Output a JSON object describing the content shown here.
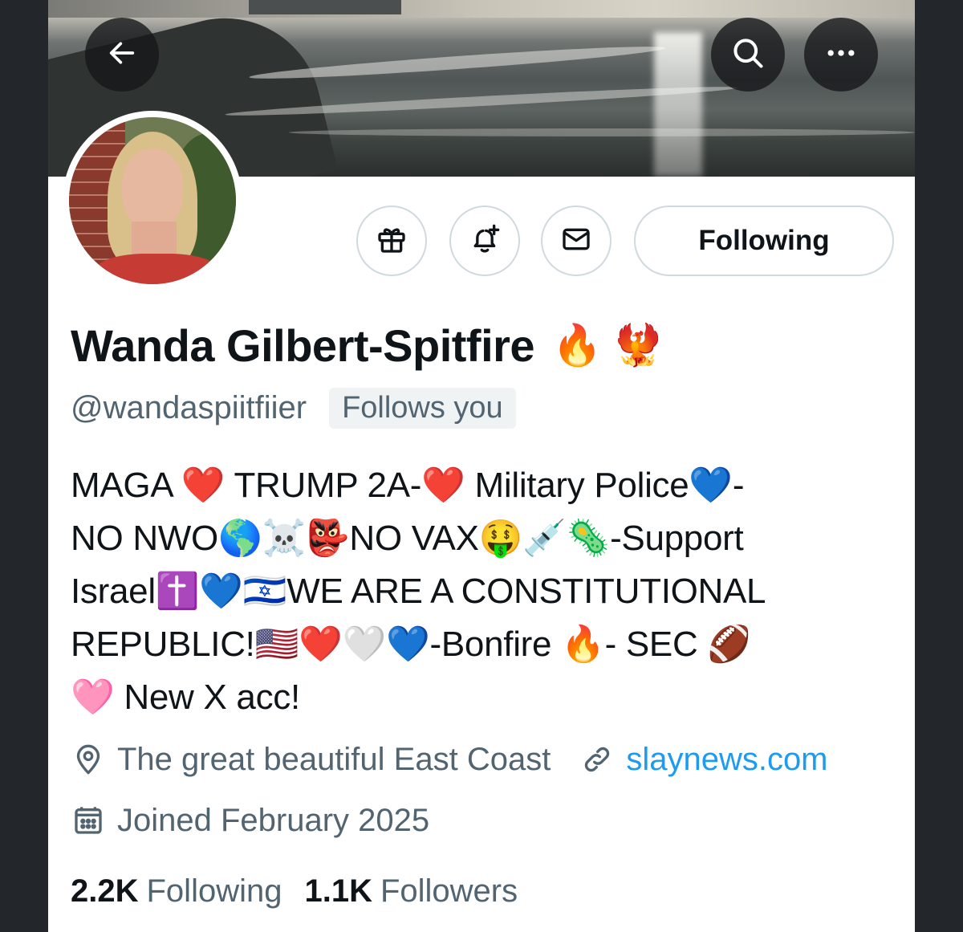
{
  "header": {
    "back_icon": "arrow-left-icon",
    "search_icon": "search-icon",
    "more_icon": "more-horizontal-icon"
  },
  "actions": {
    "gift_icon": "gift-icon",
    "notify_icon": "bell-plus-icon",
    "message_icon": "envelope-icon",
    "following_label": "Following"
  },
  "profile": {
    "name": "Wanda Gilbert-Spitfire",
    "name_emoji": "🔥 🐦‍🔥",
    "handle": "@wandaspiitfiier",
    "follows_you": "Follows you",
    "bio_lines": [
      "MAGA ❤️ TRUMP 2A-❤️ Military Police💙-",
      "NO NWO🌎☠️👺NO VAX🤑💉🦠-Support",
      "Israel✝️💙🇮🇱WE ARE A CONSTITUTIONAL",
      "REPUBLIC!🇺🇸❤️🤍💙-Bonfire 🔥- SEC 🏈",
      "🩷 New X acc!"
    ],
    "location": "The great beautiful East Coast",
    "website": "slaynews.com",
    "joined": "Joined February 2025"
  },
  "stats": {
    "following_count": "2.2K",
    "following_label": "Following",
    "followers_count": "1.1K",
    "followers_label": "Followers"
  },
  "colors": {
    "accent_link": "#1d9bf0",
    "secondary_text": "#536471",
    "primary_text": "#0f1419",
    "border": "#cfd9de"
  }
}
